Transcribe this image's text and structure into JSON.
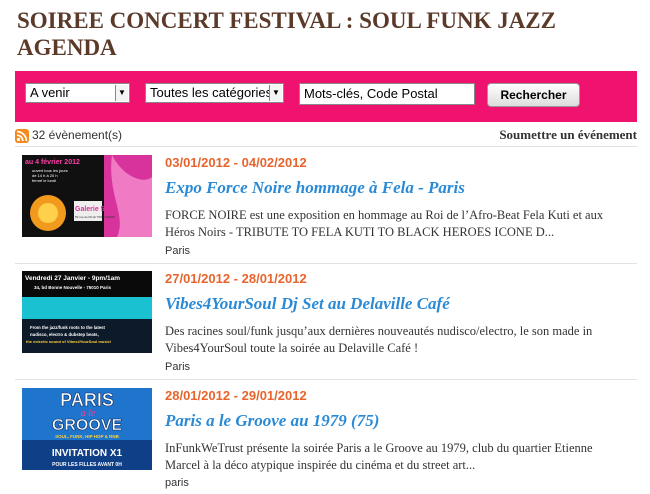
{
  "page": {
    "title": "SOIREE CONCERT FESTIVAL : SOUL FUNK JAZZ AGENDA"
  },
  "search": {
    "period_value": "A venir",
    "category_value": "Toutes les catégories",
    "keyword_placeholder": "Mots-clés, Code Postal",
    "submit_label": "Rechercher"
  },
  "summary": {
    "count_label": "32 évènement(s)",
    "submit_event_label": "Soumettre un événement"
  },
  "events": [
    {
      "dates": "03/01/2012 - 04/02/2012",
      "title": "Expo Force Noire hommage à Fela - Paris",
      "description": "FORCE NOIRE est une exposition en hommage au Roi de l’Afro-Beat Fela Kuti et aux Héros Noirs - TRIBUTE TO FELA KUTI TO BLACK HEROES ICONE D...",
      "city": "Paris",
      "thumb": {
        "line1": "au 4 février 2012",
        "line2": "ouvert tous les jours",
        "line3": "de 14 h à 20 h",
        "line4": "fermé le lundi",
        "venue": "Galerie 59",
        "address": "59 rue de Rivoli 75001 PARIS"
      }
    },
    {
      "dates": "27/01/2012 - 28/01/2012",
      "title": "Vibes4YourSoul Dj Set au Delaville Café",
      "description": "Des racines soul/funk jusqu’aux dernières nouveautés nudisco/electro, le son made in Vibes4YourSoul toute la soirée au Delaville Café !",
      "city": "Paris",
      "thumb": {
        "line1": "Vendredi 27 Janvier - 9pm/1am",
        "line2": "34, bd Bonne Nouvelle - 75010 Paris",
        "line3": "From the jazz/funk roots to the latest",
        "line4": "nudisco, electro & dubstep beats,",
        "line5": "the eclectic sound of Vibes4YourSoul music!"
      }
    },
    {
      "dates": "28/01/2012 - 29/01/2012",
      "title": "Paris a le Groove au 1979 (75)",
      "description": "InFunkWeTrust présente la soirée Paris a le Groove au 1979, club du quartier Etienne Marcel à la déco atypique inspirée du cinéma et du street art...",
      "city": "paris",
      "thumb": {
        "line1": "PARIS",
        "line2": "a le",
        "line3": "GROOVE",
        "line4": "SOUL, FUNK, HIP HOP & RNB",
        "line5": "INVITATION X1",
        "line6": "POUR LES FILLES AVANT 0H"
      }
    }
  ]
}
